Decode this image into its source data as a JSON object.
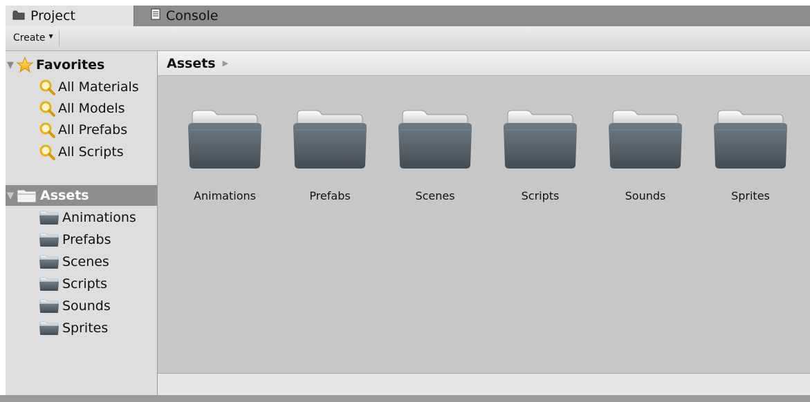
{
  "tabs": [
    {
      "label": "Project",
      "icon": "folder-icon",
      "active": true
    },
    {
      "label": "Console",
      "icon": "console-icon",
      "active": false
    }
  ],
  "toolbar": {
    "create_label": "Create"
  },
  "sidebar": {
    "favorites": {
      "label": "Favorites",
      "items": [
        {
          "label": "All Materials"
        },
        {
          "label": "All Models"
        },
        {
          "label": "All Prefabs"
        },
        {
          "label": "All Scripts"
        }
      ]
    },
    "assets": {
      "label": "Assets",
      "items": [
        {
          "label": "Animations"
        },
        {
          "label": "Prefabs"
        },
        {
          "label": "Scenes"
        },
        {
          "label": "Scripts"
        },
        {
          "label": "Sounds"
        },
        {
          "label": "Sprites"
        }
      ]
    }
  },
  "main": {
    "breadcrumb": "Assets",
    "folders": [
      {
        "label": "Animations"
      },
      {
        "label": "Prefabs"
      },
      {
        "label": "Scenes"
      },
      {
        "label": "Scripts"
      },
      {
        "label": "Sounds"
      },
      {
        "label": "Sprites"
      }
    ]
  },
  "colors": {
    "tab_bar": "#8d8d8d",
    "sidebar_bg": "#dedede",
    "selected_row": "#8e8e8e",
    "content_bg": "#c7c7c7",
    "folder_body": "#5e6a74",
    "star": "#f4c21a",
    "magnifier": "#e0b21a"
  }
}
